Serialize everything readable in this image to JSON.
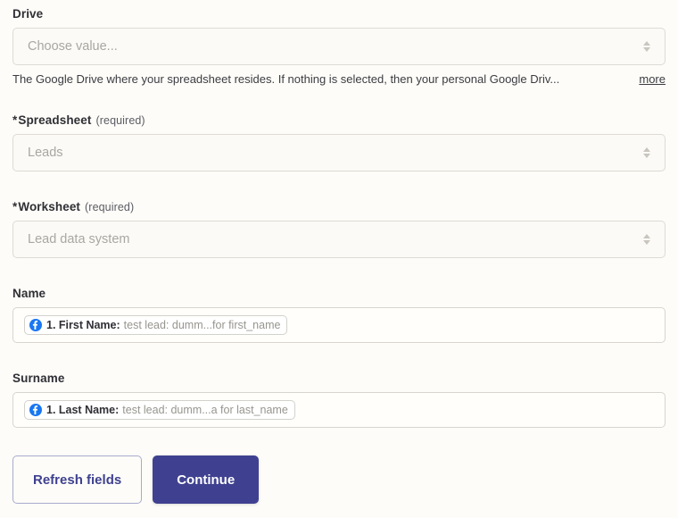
{
  "fields": {
    "drive": {
      "label": "Drive",
      "required": false,
      "required_note": "",
      "placeholder": "Choose value...",
      "value": "",
      "helper_text": "The Google Drive where your spreadsheet resides. If nothing is selected, then your personal Google Driv...",
      "more_label": "more",
      "chevron_icon": "chevron-up-down-icon"
    },
    "spreadsheet": {
      "label": "* Spreadsheet",
      "star": "*",
      "label_text": "Spreadsheet",
      "required": true,
      "required_note": "(required)",
      "value": "Leads",
      "chevron_icon": "chevron-up-down-icon"
    },
    "worksheet": {
      "label": "* Worksheet",
      "star": "*",
      "label_text": "Worksheet",
      "required": true,
      "required_note": "(required)",
      "value": "Lead data system",
      "chevron_icon": "chevron-up-down-icon"
    },
    "name": {
      "label": "Name",
      "chip": {
        "icon": "facebook-icon",
        "key": "1. First Name:",
        "value": "test lead: dumm...for first_name"
      }
    },
    "surname": {
      "label": "Surname",
      "chip": {
        "icon": "facebook-icon",
        "key": "1. Last Name:",
        "value": "test lead: dumm...a for last_name"
      }
    }
  },
  "buttons": {
    "refresh": "Refresh fields",
    "continue": "Continue"
  },
  "colors": {
    "page_background": "#fdfcf8",
    "primary": "#3f4190",
    "facebook_blue": "#1877f2",
    "field_border": "#dedbd4",
    "muted_text": "#a9a7a2"
  }
}
